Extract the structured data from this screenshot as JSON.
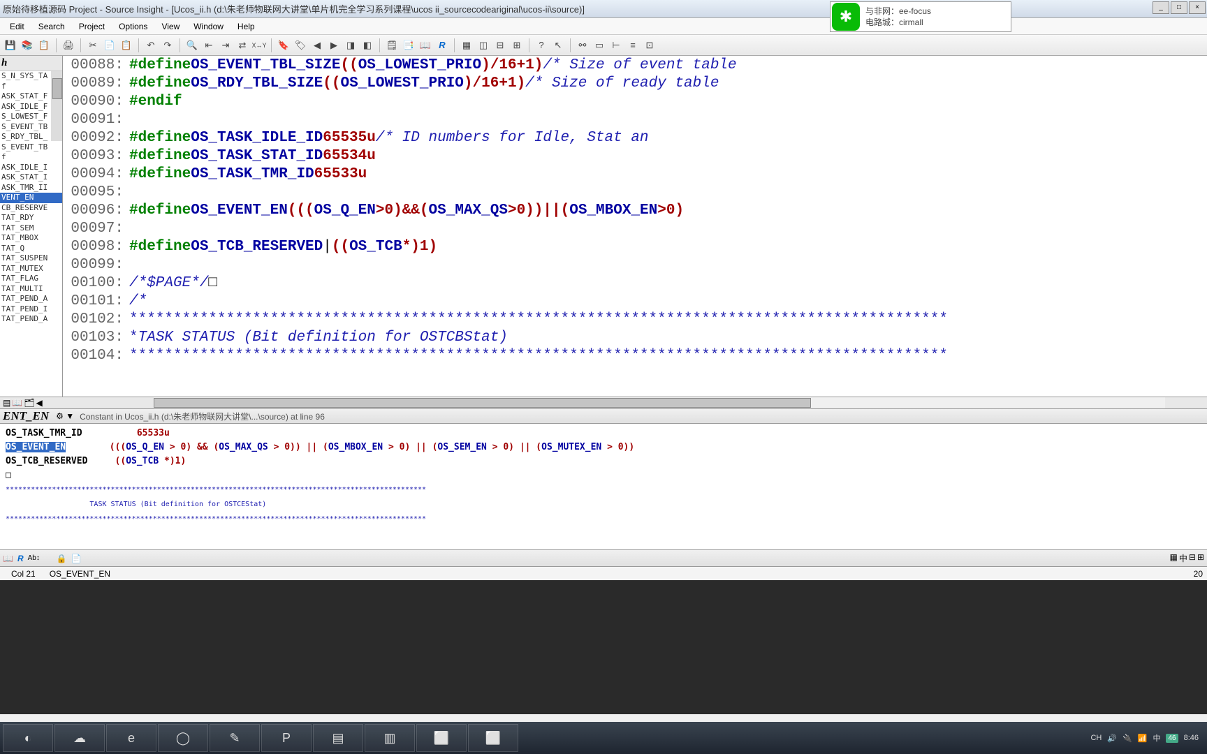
{
  "title": "原始待移植源码 Project - Source Insight - [Ucos_ii.h (d:\\朱老师物联网大讲堂\\单片机完全学习系列课程\\ucos ii_sourcecodeariginal\\ucos-ii\\source)]",
  "menu": [
    "Edit",
    "Search",
    "Project",
    "Options",
    "View",
    "Window",
    "Help"
  ],
  "sidebar_head": "h",
  "sidebar_items": [
    "S_N_SYS_TA",
    "f",
    "ASK_STAT_F",
    "ASK_IDLE_F",
    "S_LOWEST_F",
    "S_EVENT_TB",
    "S_RDY_TBL_",
    "",
    "S_EVENT_TB",
    "f",
    "ASK_IDLE_I",
    "ASK_STAT_I",
    "ASK_TMR_II",
    "VENT_EN",
    "CB_RESERVE",
    "TAT_RDY",
    "TAT_SEM",
    "TAT_MBOX",
    "TAT_Q",
    "TAT_SUSPEN",
    "TAT_MUTEX",
    "TAT_FLAG",
    "TAT_MULTI",
    "TAT_PEND_A",
    "TAT_PEND_I",
    "TAT_PEND_A"
  ],
  "sidebar_sel": 13,
  "code": [
    {
      "n": "00088",
      "h": "<span class='kw'>#define</span>  <span class='sym'>OS_EVENT_TBL_SIZE</span> <span class='op'>((</span><span class='sym'>OS_LOWEST_PRIO</span><span class='op'>)</span> <span class='op'>/</span> <span class='num'>16</span> <span class='op'>+</span> <span class='num'>1</span><span class='op'>)</span>   <span class='cmt'>/* Size of event table</span>"
    },
    {
      "n": "00089",
      "h": "<span class='kw'>#define</span>  <span class='sym'>OS_RDY_TBL_SIZE</span>   <span class='op'>((</span><span class='sym'>OS_LOWEST_PRIO</span><span class='op'>)</span> <span class='op'>/</span> <span class='num'>16</span> <span class='op'>+</span> <span class='num'>1</span><span class='op'>)</span>   <span class='cmt'>/* Size of ready table</span>"
    },
    {
      "n": "00090",
      "h": "<span class='kw'>#endif</span>"
    },
    {
      "n": "00091",
      "h": ""
    },
    {
      "n": "00092",
      "h": "<span class='kw'>#define</span>  <span class='sym'>OS_TASK_IDLE_ID</span>          <span class='num'>65535u</span>                     <span class='cmt'>/* ID numbers for Idle, Stat an</span>"
    },
    {
      "n": "00093",
      "h": "<span class='kw'>#define</span>  <span class='sym'>OS_TASK_STAT_ID</span>          <span class='num'>65534u</span>"
    },
    {
      "n": "00094",
      "h": "<span class='kw'>#define</span>  <span class='sym'>OS_TASK_TMR_ID</span>           <span class='num'>65533u</span>"
    },
    {
      "n": "00095",
      "h": ""
    },
    {
      "n": "00096",
      "h": "<span class='kw'>#define</span>  <span class='sym'>OS_EVENT_EN</span>           <span class='op'>(((</span><span class='sym'>OS_Q_EN</span> <span class='op'>&gt;</span> <span class='num'>0</span><span class='op'>)</span> <span class='op'>&amp;&amp;</span> <span class='op'>(</span><span class='sym'>OS_MAX_QS</span> <span class='op'>&gt;</span> <span class='num'>0</span><span class='op'>))</span> <span class='op'>||</span> <span class='op'>(</span><span class='sym'>OS_MBOX_EN</span> <span class='op'>&gt;</span> <span class='num'>0</span><span class='op'>)</span>"
    },
    {
      "n": "00097",
      "h": ""
    },
    {
      "n": "00098",
      "h": "<span class='kw'>#define</span>  <span class='sym'>OS_TCB_RESERVED</span><span class='pln'>|</span>        <span class='op'>((</span><span class='sym'>OS_TCB</span> <span class='op'>*)</span><span class='num'>1</span><span class='op'>)</span>"
    },
    {
      "n": "00099",
      "h": ""
    },
    {
      "n": "00100",
      "h": "<span class='cmt'>/*$PAGE*/</span><span class='pln'>□</span>"
    },
    {
      "n": "00101",
      "h": "<span class='cmt'>/*</span>"
    },
    {
      "n": "00102",
      "h": "<span class='star'>*********************************************************************************************</span>"
    },
    {
      "n": "00103",
      "h": "<span class='star'>*</span>                               <span class='cmt'>TASK STATUS (Bit definition for OSTCBStat)</span>"
    },
    {
      "n": "00104",
      "h": "<span class='star'>*********************************************************************************************</span>"
    }
  ],
  "ctx_symbol": "ENT_EN",
  "ctx_desc": "Constant in Ucos_ii.h (d:\\朱老师物联网大讲堂\\...\\source) at line 96",
  "ctx_lines": [
    {
      "h": "<span style='font-weight:bold'>OS_TASK_TMR_ID</span>          <span class='num'>65533u</span>"
    },
    {
      "h": ""
    },
    {
      "h": "<span class='hlsel'>OS_EVENT_EN</span>        <span class='op'>(((</span><span class='sym'>OS_Q_EN</span> <span class='op'>&gt;</span> <span class='num'>0</span><span class='op'>) &amp;&amp; (</span><span class='sym'>OS_MAX_QS</span> <span class='op'>&gt;</span> <span class='num'>0</span><span class='op'>)) || (</span><span class='sym'>OS_MBOX_EN</span> <span class='op'>&gt;</span> <span class='num'>0</span><span class='op'>) || (</span><span class='sym'>OS_SEM_EN</span> <span class='op'>&gt;</span> <span class='num'>0</span><span class='op'>) || (</span><span class='sym'>OS_MUTEX_EN</span> <span class='op'>&gt;</span> <span class='num'>0</span><span class='op'>))</span>"
    },
    {
      "h": ""
    },
    {
      "h": "<span style='font-weight:bold'>OS_TCB_RESERVED</span>     <span class='op'>((</span><span class='sym'>OS_TCB</span> <span class='op'>*)</span><span class='num'>1</span><span class='op'>)</span>"
    },
    {
      "h": ""
    },
    {
      "h": "<span class='pln'>□</span>"
    },
    {
      "h": "<span class='sm'>****************************************************************************************************</span>"
    },
    {
      "h": "<span class='sm'>                    TASK STATUS (Bit definition for OSTCEStat)</span>"
    },
    {
      "h": "<span class='sm'>****************************************************************************************************</span>"
    }
  ],
  "status": {
    "col": "Col 21",
    "sym": "OS_EVENT_EN"
  },
  "wechat": {
    "line1": "与非网：ee-focus",
    "line2": "电路城：cirmall"
  },
  "tray": {
    "ime": "CH",
    "time": "8:46",
    "date": "20",
    "ime2": "中",
    "num": "46"
  },
  "taskbar_icons": [
    "◐",
    "☁",
    "e",
    "◯",
    "✎",
    "P",
    "▤",
    "▥",
    "⬜",
    "⬜"
  ]
}
